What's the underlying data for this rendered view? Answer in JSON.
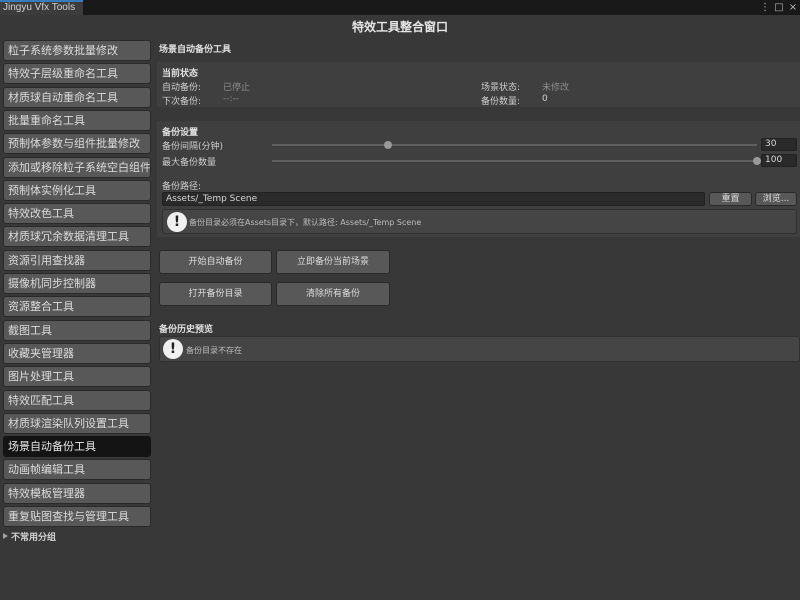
{
  "tab": {
    "title": "Jingyu Vfx Tools",
    "menu_glyph": "⋮",
    "max_glyph": "□",
    "close_glyph": "×"
  },
  "window_title": "特效工具整合窗口",
  "sidebar": {
    "items": [
      {
        "label": "粒子系统参数批量修改"
      },
      {
        "label": "特效子层级重命名工具"
      },
      {
        "label": "材质球自动重命名工具"
      },
      {
        "label": "批量重命名工具"
      },
      {
        "label": "预制体参数与组件批量修改"
      },
      {
        "label": "添加或移除粒子系统空白组件"
      },
      {
        "label": "预制体实例化工具"
      },
      {
        "label": "特效改色工具"
      },
      {
        "label": "材质球冗余数据清理工具"
      },
      {
        "label": "资源引用查找器"
      },
      {
        "label": "摄像机同步控制器"
      },
      {
        "label": "资源整合工具"
      },
      {
        "label": "截图工具"
      },
      {
        "label": "收藏夹管理器"
      },
      {
        "label": "图片处理工具"
      },
      {
        "label": "特效匹配工具"
      },
      {
        "label": "材质球渲染队列设置工具"
      },
      {
        "label": "场景自动备份工具",
        "active": true
      },
      {
        "label": "动画帧编辑工具"
      },
      {
        "label": "特效模板管理器"
      },
      {
        "label": "重复贴图查找与管理工具"
      }
    ],
    "group_label": "不常用分组"
  },
  "content": {
    "header": "场景自动备份工具",
    "status": {
      "title": "当前状态",
      "auto_backup_label": "自动备份:",
      "auto_backup_value": "已停止",
      "next_backup_label": "下次备份:",
      "next_backup_value": "--:--",
      "scene_state_label": "场景状态:",
      "scene_state_value": "未修改",
      "backup_count_label": "备份数量:",
      "backup_count_value": "0"
    },
    "settings": {
      "title": "备份设置",
      "interval_label": "备份间隔(分钟)",
      "interval_value": "30",
      "interval_fraction": 0.24,
      "max_label": "最大备份数量",
      "max_value": "100",
      "max_fraction": 1.0,
      "path_label": "备份路径:",
      "path_value": "Assets/_Temp Scene",
      "reset_label": "重置",
      "browse_label": "浏览...",
      "path_help": "备份目录必须在Assets目录下，默认路径: Assets/_Temp Scene"
    },
    "actions": {
      "start_auto": "开始自动备份",
      "backup_now": "立即备份当前场景",
      "open_dir": "打开备份目录",
      "clear_all": "清除所有备份"
    },
    "history": {
      "title": "备份历史预览",
      "message": "备份目录不存在"
    },
    "help_glyph": "!"
  }
}
